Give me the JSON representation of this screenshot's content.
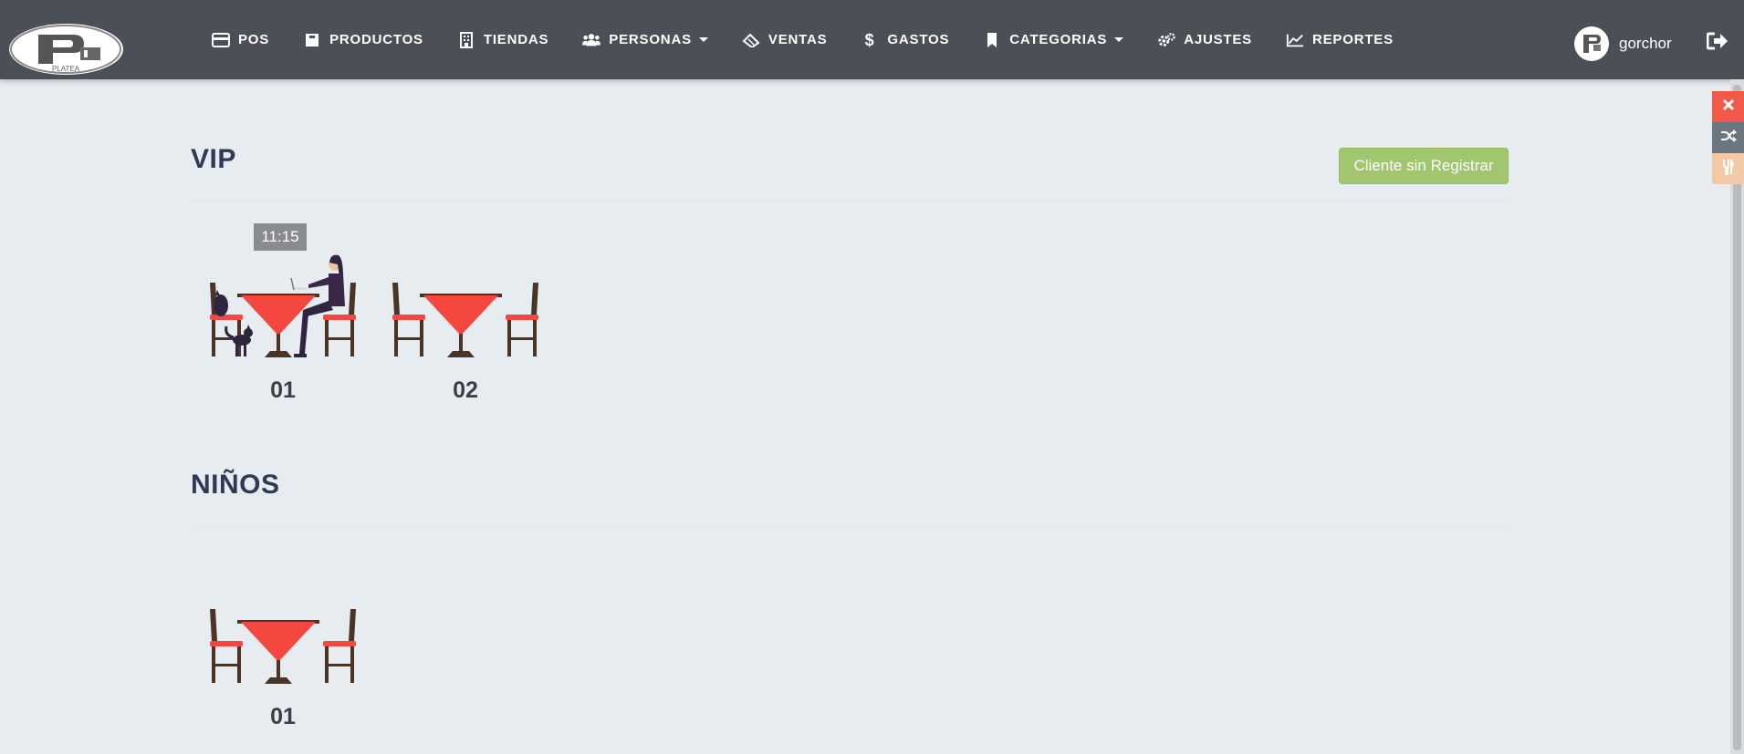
{
  "navbar": {
    "brand": "PLATEA",
    "items": [
      {
        "label": "POS",
        "icon": "credit-card-icon"
      },
      {
        "label": "PRODUCTOS",
        "icon": "archive-icon"
      },
      {
        "label": "TIENDAS",
        "icon": "building-icon"
      },
      {
        "label": "PERSONAS",
        "icon": "users-icon",
        "dropdown": true
      },
      {
        "label": "VENTAS",
        "icon": "ticket-icon"
      },
      {
        "label": "GASTOS",
        "icon": "dollar-icon"
      },
      {
        "label": "CATEGORIAS",
        "icon": "bookmark-icon",
        "dropdown": true
      },
      {
        "label": "AJUSTES",
        "icon": "gears-icon"
      },
      {
        "label": "REPORTES",
        "icon": "line-chart-icon"
      }
    ],
    "user": "gorchor"
  },
  "colors": {
    "navbar": "#4b4f56",
    "background": "#e7ecf1",
    "accent_green": "#a2c570",
    "close_red": "#f15a48",
    "table_red": "#f4473f"
  },
  "actions": {
    "unregistered_client": "Cliente sin Registrar"
  },
  "sections": [
    {
      "title": "VIP",
      "tables": [
        {
          "number": "01",
          "occupied": true,
          "timer": "11:15"
        },
        {
          "number": "02",
          "occupied": false
        }
      ]
    },
    {
      "title": "NIÑOS",
      "tables": [
        {
          "number": "01",
          "occupied": false
        }
      ]
    }
  ]
}
